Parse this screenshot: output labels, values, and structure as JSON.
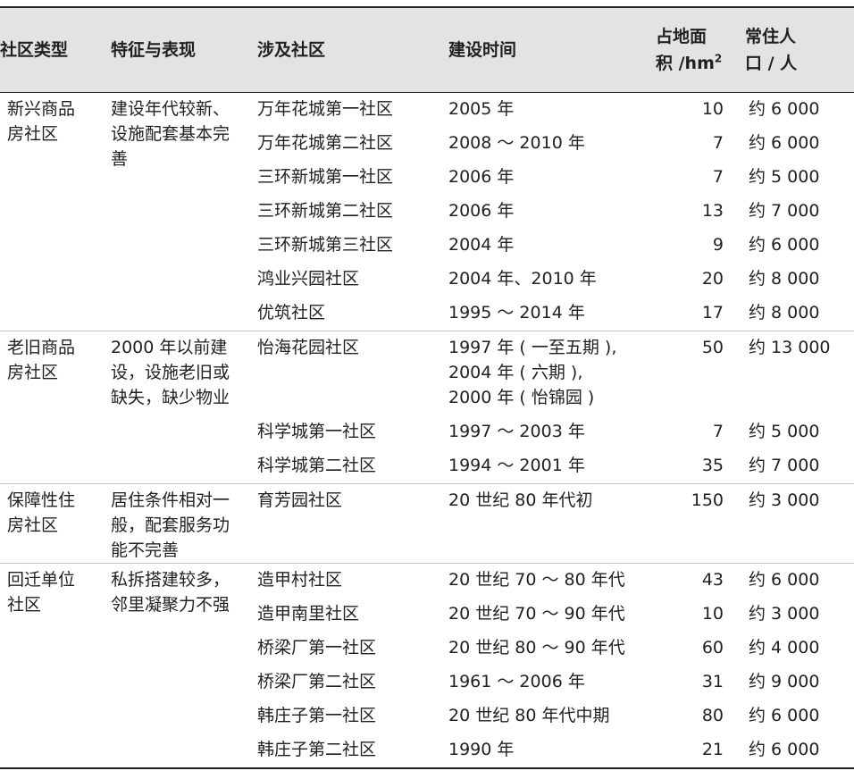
{
  "headers": {
    "type": "社区类型",
    "feature": "特征与表现",
    "community": "涉及社区",
    "time": "建设时间",
    "area_line1": "占地面",
    "area_line2": "积 /hm",
    "area_sup": "2",
    "pop_line1": "常住人",
    "pop_line2": "口 / 人"
  },
  "groups": [
    {
      "type": "新兴商品房社区",
      "feature": "建设年代较新、设施配套基本完善",
      "rows": [
        {
          "name": "万年花城第一社区",
          "time": [
            "2005 年"
          ],
          "area": "10",
          "pop": "约 6 000"
        },
        {
          "name": "万年花城第二社区",
          "time": [
            "2008 ～ 2010 年"
          ],
          "area": "7",
          "pop": "约 6 000"
        },
        {
          "name": "三环新城第一社区",
          "time": [
            "2006 年"
          ],
          "area": "7",
          "pop": "约 5 000"
        },
        {
          "name": "三环新城第二社区",
          "time": [
            "2006 年"
          ],
          "area": "13",
          "pop": "约 7 000"
        },
        {
          "name": "三环新城第三社区",
          "time": [
            "2004 年"
          ],
          "area": "9",
          "pop": "约 6 000"
        },
        {
          "name": "鸿业兴园社区",
          "time": [
            "2004 年、2010 年"
          ],
          "area": "20",
          "pop": "约 8 000"
        },
        {
          "name": "优筑社区",
          "time": [
            "1995 ～ 2014 年"
          ],
          "area": "17",
          "pop": "约 8 000"
        }
      ]
    },
    {
      "type": "老旧商品房社区",
      "feature": "2000 年以前建设，设施老旧或缺失，缺少物业",
      "rows": [
        {
          "name": "怡海花园社区",
          "time": [
            "1997 年 ( 一至五期 ),",
            "2004 年 ( 六期 ),",
            "2000 年 ( 怡锦园 )"
          ],
          "area": "50",
          "pop": "约 13 000"
        },
        {
          "name": "科学城第一社区",
          "time": [
            "1997 ～ 2003 年"
          ],
          "area": "7",
          "pop": "约 5 000"
        },
        {
          "name": "科学城第二社区",
          "time": [
            "1994 ～ 2001 年"
          ],
          "area": "35",
          "pop": "约 7 000"
        }
      ]
    },
    {
      "type": "保障性住房社区",
      "feature": "居住条件相对一般，配套服务功能不完善",
      "rows": [
        {
          "name": "育芳园社区",
          "time": [
            "20 世纪 80 年代初"
          ],
          "area": "150",
          "pop": "约 3 000"
        }
      ]
    },
    {
      "type": "回迁单位社区",
      "feature": "私拆搭建较多，邻里凝聚力不强",
      "rows": [
        {
          "name": "造甲村社区",
          "time": [
            "20 世纪 70 ～ 80 年代"
          ],
          "area": "43",
          "pop": "约 6 000"
        },
        {
          "name": "造甲南里社区",
          "time": [
            "20 世纪 70 ～ 90 年代"
          ],
          "area": "10",
          "pop": "约 3 000"
        },
        {
          "name": "桥梁厂第一社区",
          "time": [
            "20 世纪 80 ～ 90 年代"
          ],
          "area": "60",
          "pop": "约 4 000"
        },
        {
          "name": "桥梁厂第二社区",
          "time": [
            "1961 ～ 2006 年"
          ],
          "area": "31",
          "pop": "约 9 000"
        },
        {
          "name": "韩庄子第一社区",
          "time": [
            "20 世纪 80 年代中期"
          ],
          "area": "80",
          "pop": "约 6 000"
        },
        {
          "name": "韩庄子第二社区",
          "time": [
            "1990 年"
          ],
          "area": "21",
          "pop": "约 6 000"
        }
      ]
    }
  ]
}
